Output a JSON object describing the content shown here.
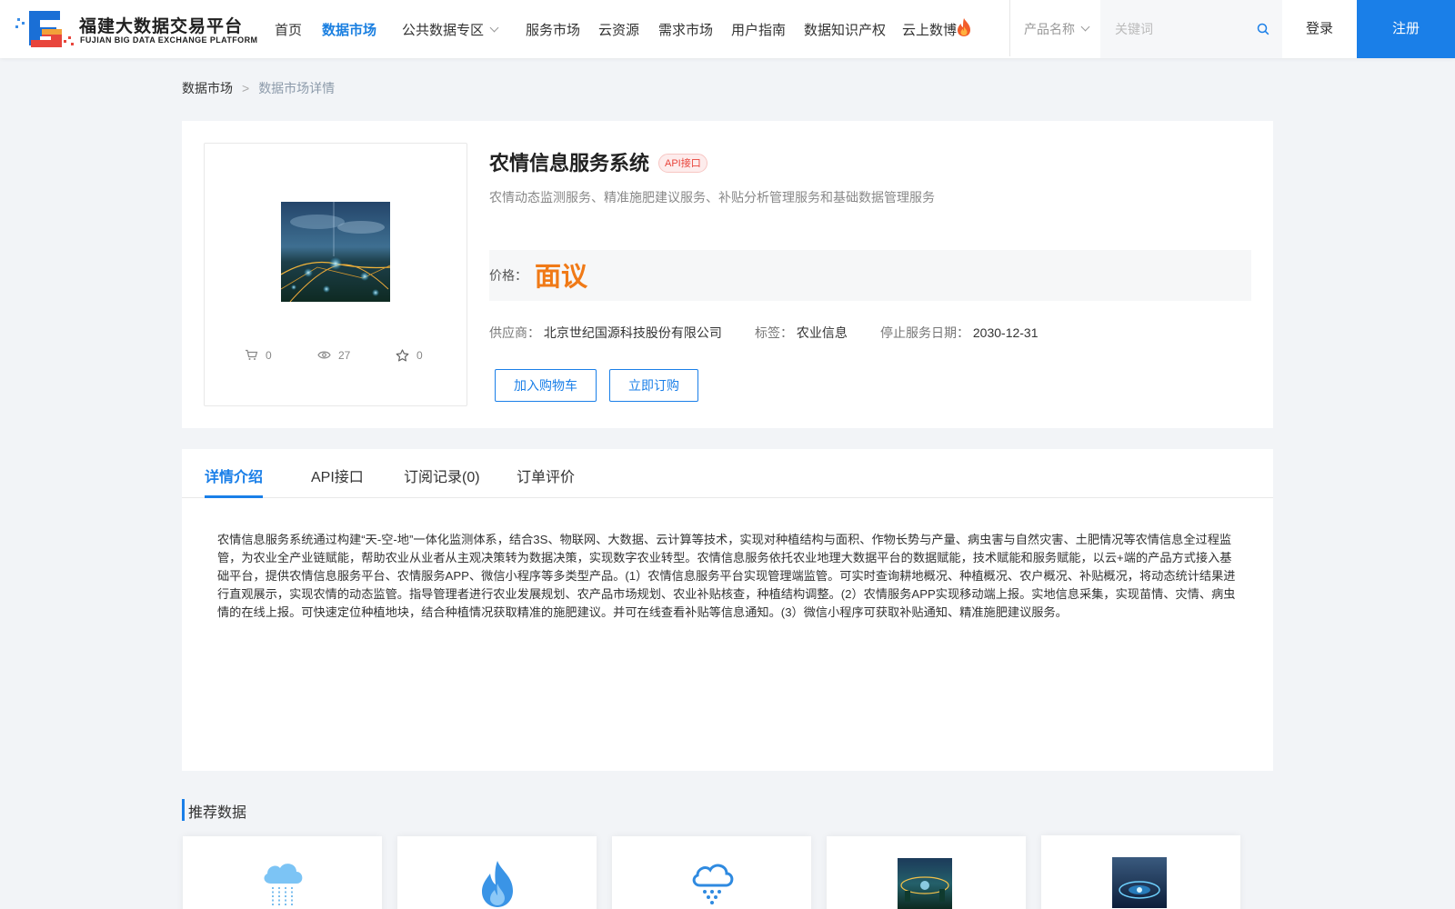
{
  "brand": {
    "name": "福建大数据交易平台",
    "subtitle": "FUJIAN BIG DATA EXCHANGE PLATFORM",
    "colors": {
      "primary": "#1a7fe8",
      "accent_red": "#e8453c",
      "price_orange": "#f07a17"
    }
  },
  "nav": {
    "items": [
      {
        "label": "首页"
      },
      {
        "label": "数据市场"
      },
      {
        "label": "公共数据专区"
      },
      {
        "label": "服务市场"
      },
      {
        "label": "云资源"
      },
      {
        "label": "需求市场"
      },
      {
        "label": "用户指南"
      },
      {
        "label": "数据知识产权"
      },
      {
        "label": "云上数博"
      }
    ],
    "active_index": 1,
    "hot_icon": "flame-icon"
  },
  "search": {
    "category_label": "产品名称",
    "placeholder": "关键词",
    "value": ""
  },
  "auth": {
    "login_label": "登录",
    "register_label": "注册"
  },
  "breadcrumb": {
    "parent": "数据市场",
    "separator": ">",
    "current": "数据市场详情"
  },
  "product": {
    "title": "农情信息服务系统",
    "badge": "API接口",
    "description": "农情动态监测服务、精准施肥建议服务、补贴分析管理服务和基础数据管理服务",
    "price_label": "价格：",
    "price_value": "面议",
    "stats": {
      "cart_count": "0",
      "view_count": "27",
      "favorite_count": "0"
    },
    "meta": {
      "supplier_label": "供应商：",
      "supplier_value": "北京世纪国源科技股份有限公司",
      "tag_label": "标签：",
      "tag_value": "农业信息",
      "end_date_label": "停止服务日期：",
      "end_date_value": "2030-12-31"
    },
    "actions": {
      "add_to_cart": "加入购物车",
      "subscribe": "立即订购"
    }
  },
  "tabs": {
    "items": [
      {
        "label": "详情介绍"
      },
      {
        "label": "API接口"
      },
      {
        "label": "订阅记录(0)"
      },
      {
        "label": "订单评价"
      }
    ],
    "active_index": 0
  },
  "detail": {
    "text": "农情信息服务系统通过构建“天-空-地”一体化监测体系，结合3S、物联网、大数据、云计算等技术，实现对种植结构与面积、作物长势与产量、病虫害与自然灾害、土肥情况等农情信息全过程监管，为农业全产业链赋能，帮助农业从业者从主观决策转为数据决策，实现数字农业转型。农情信息服务依托农业地理大数据平台的数据赋能，技术赋能和服务赋能，以云+端的产品方式接入基础平台，提供农情信息服务平台、农情服务APP、微信小程序等多类型产品。(1）农情信息服务平台实现管理端监管。可实时查询耕地概况、种植概况、农户概况、补贴概况，将动态统计结果进行直观展示，实现农情的动态监管。指导管理者进行农业发展规划、农产品市场规划、农业补贴核查，种植结构调整。(2）农情服务APP实现移动端上报。实地信息采集，实现苗情、灾情、病虫情的在线上报。可快速定位种植地块，结合种植情况获取精准的施肥建议。并可在线查看补贴等信息通知。(3）微信小程序可获取补贴通知、精准施肥建议服务。"
  },
  "recommended": {
    "title": "推荐数据",
    "cards": [
      {
        "icon": "rain-cloud-icon"
      },
      {
        "icon": "flame-icon"
      },
      {
        "icon": "snow-cloud-icon"
      },
      {
        "icon": "city-night-thumbnail"
      },
      {
        "icon": "data-circle-thumbnail"
      }
    ]
  }
}
